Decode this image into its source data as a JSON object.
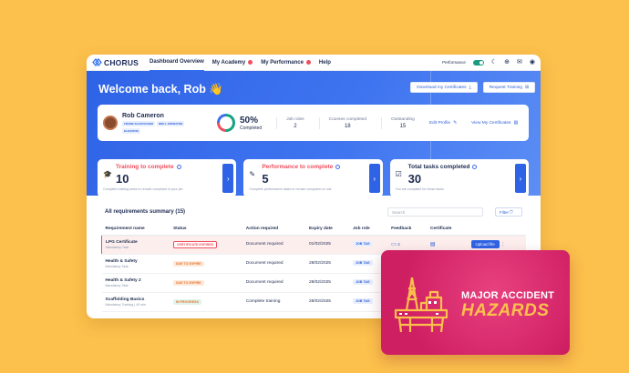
{
  "nav": {
    "logo": "CHORUS",
    "items": [
      {
        "label": "Dashboard Overview"
      },
      {
        "label": "My Academy"
      },
      {
        "label": "My Performance"
      },
      {
        "label": "Help"
      }
    ],
    "performance_label": "Performance"
  },
  "hero": {
    "welcome": "Welcome back, Rob 👋",
    "download_btn": "Download my Certificates",
    "request_btn": "Request Training"
  },
  "profile": {
    "name": "Rob Cameron",
    "tags": [
      "FRAME SCAFFOLDER",
      "DRILL OPERATOR",
      "ELEVATOR"
    ],
    "completed_pct": "50%",
    "completed_label": "Completed",
    "stats": [
      {
        "label": "Job roles",
        "value": "2"
      },
      {
        "label": "Courses completed",
        "value": "18"
      },
      {
        "label": "Outstanding",
        "value": "15"
      }
    ],
    "edit_profile": "Edit Profile",
    "view_certs": "View My Certificates"
  },
  "cards": [
    {
      "title": "Training to complete",
      "value": "10",
      "desc": "Complete training tasks to remain compliant in your job",
      "color": "#ef4e5d"
    },
    {
      "title": "Performance to complete",
      "value": "5",
      "desc": "Complete performance tasks to remain compliant on role",
      "color": "#ef4e5d"
    },
    {
      "title": "Total tasks completed",
      "value": "30",
      "desc": "You are compliant for these tasks",
      "color": "#1d2b4f"
    }
  ],
  "summary": {
    "title": "All requirements summary (15)",
    "search_placeholder": "Search",
    "filter": "Filter",
    "columns": [
      "Requirement name",
      "Status",
      "Action required",
      "Expiry date",
      "Job role",
      "Feedback",
      "Certificate"
    ],
    "rows": [
      {
        "name": "LPG Certificate",
        "sub": "Mandatory Task",
        "status": "CERTIFICATE EXPIRED",
        "action": "Document required",
        "expiry": "01/02/2025",
        "job": "JOB TAG",
        "feedback": "2",
        "upload": "Upload file"
      },
      {
        "name": "Health & Safety",
        "sub": "Mandatory Task",
        "status": "DUE TO EXPIRE",
        "action": "Document required",
        "expiry": "28/02/2025",
        "job": "JOB TAG",
        "feedback": "",
        "upload": ""
      },
      {
        "name": "Health & Safety 2",
        "sub": "Mandatory Task",
        "status": "DUE TO EXPIRE",
        "action": "Document required",
        "expiry": "28/02/2025",
        "job": "JOB TAG",
        "feedback": "",
        "upload": ""
      },
      {
        "name": "Scaffolding Basics",
        "sub": "Mandatory Training | 40 min",
        "status": "IN PROGRESS",
        "action": "Complete training",
        "expiry": "28/02/2025",
        "job": "JOB TAG",
        "feedback": "",
        "upload": ""
      }
    ]
  },
  "promo": {
    "line1": "MAJOR ACCIDENT",
    "line2": "HAZARDS"
  }
}
